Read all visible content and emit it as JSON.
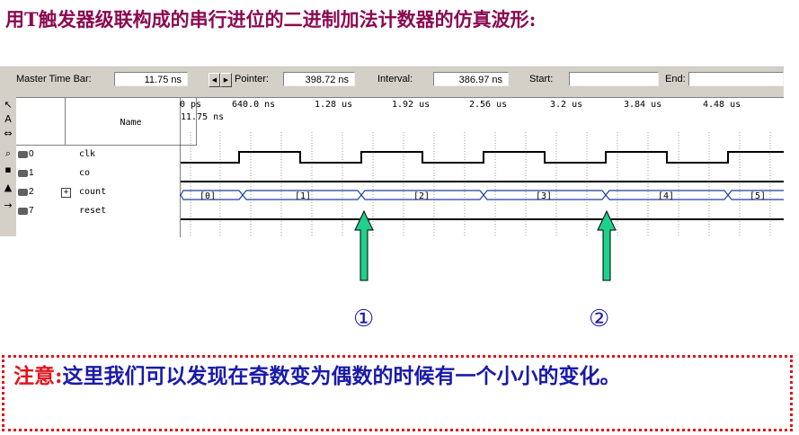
{
  "slide_title": "用T触发器级联构成的串行进位的二进制加法计数器的仿真波形:",
  "toolbar": {
    "master_time_bar_label": "Master Time Bar:",
    "master_time_bar_value": "11.75 ns",
    "pointer_label": "Pointer:",
    "pointer_value": "398.72 ns",
    "interval_label": "Interval:",
    "interval_value": "386.97 ns",
    "start_label": "Start:",
    "start_value": "",
    "end_label": "End:",
    "end_value": ""
  },
  "column_header": "Name",
  "time_ticks": [
    "0 ps",
    "640.0 ns",
    "1.28 us",
    "1.92 us",
    "2.56 us",
    "3.2 us",
    "3.84 us",
    "4.48 us"
  ],
  "pointer_readout": "11.75 ns",
  "signals": [
    {
      "index": "0",
      "name": "clk",
      "io": "input"
    },
    {
      "index": "1",
      "name": "co",
      "io": "output"
    },
    {
      "index": "2",
      "name": "count",
      "io": "output",
      "expandable": true
    },
    {
      "index": "7",
      "name": "reset",
      "io": "input"
    }
  ],
  "count_values": [
    "[0]",
    "[1]",
    "[2]",
    "[3]",
    "[4]",
    "[5]"
  ],
  "markers": [
    "①",
    "②"
  ],
  "note": {
    "lead": "注意:",
    "body": "这里我们可以发现在奇数变为偶数的时候有一个小小的变化。"
  },
  "colors": {
    "title": "#8b0a50",
    "note_text": "#1a1aaa",
    "note_lead": "#e2141c",
    "arrow_fill": "#1fd08c",
    "bus_wave": "#1f3fa0"
  },
  "icons": [
    "input-pin-icon",
    "output-pin-icon",
    "expand-plus-icon",
    "arrow-up-icon"
  ]
}
